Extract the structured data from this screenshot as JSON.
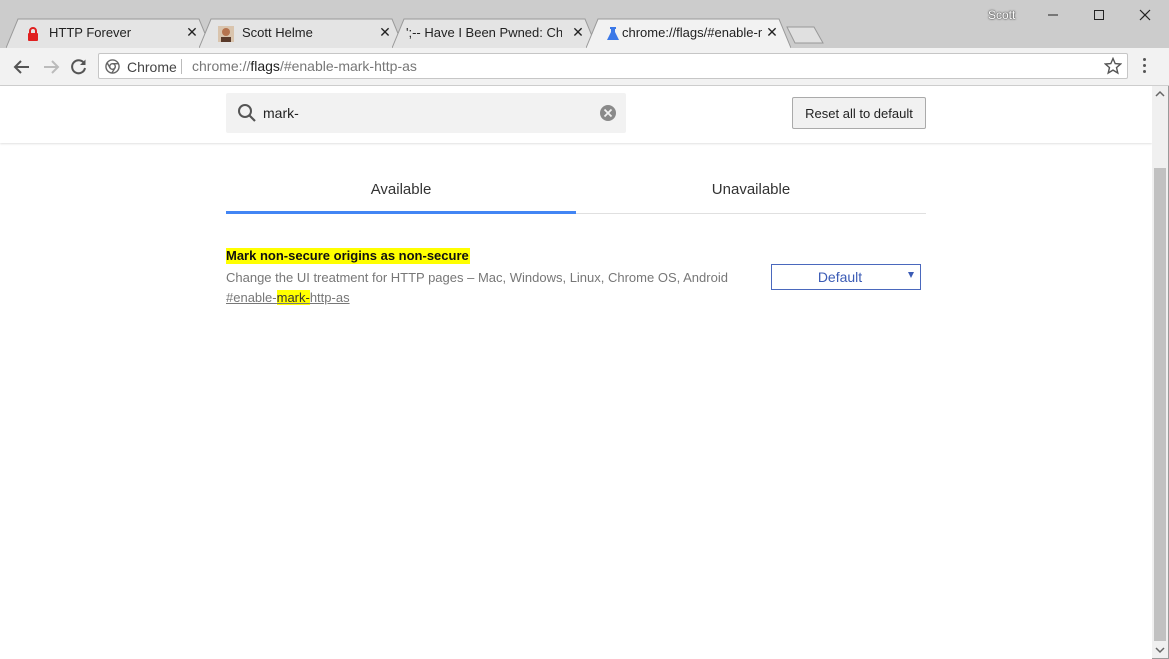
{
  "window": {
    "user": "Scott",
    "controls": {
      "minimize": "minimize",
      "maximize": "maximize",
      "close": "close"
    }
  },
  "tabs": [
    {
      "title": "HTTP Forever",
      "icon": "lock-icon",
      "icon_color": "#e02020"
    },
    {
      "title": "Scott Helme",
      "icon": "avatar-icon"
    },
    {
      "title": "';-- Have I Been Pwned: Chec",
      "icon": "hibp-icon"
    },
    {
      "title": "chrome://flags/#enable-m",
      "icon": "flask-icon",
      "icon_color": "#3b78e7",
      "active": true
    }
  ],
  "toolbar": {
    "site_chip": "Chrome",
    "url_prefix": "chrome://",
    "url_host": "flags",
    "url_rest": "/#enable-mark-http-as"
  },
  "header": {
    "search_value": "mark-",
    "reset_label": "Reset all to default"
  },
  "flag_tabs": [
    {
      "label": "Available",
      "active": true
    },
    {
      "label": "Unavailable",
      "active": false
    }
  ],
  "experiment": {
    "name": "Mark non-secure origins as non-secure",
    "description": "Change the UI treatment for HTTP pages – Mac, Windows, Linux, Chrome OS, Android",
    "permalink_before": "#enable-",
    "permalink_highlight": "mark-",
    "permalink_after": "http-as",
    "selected": "Default"
  },
  "colors": {
    "accent": "#4285f4",
    "highlight": "#ffff00",
    "select_blue": "#3b5bb5"
  }
}
